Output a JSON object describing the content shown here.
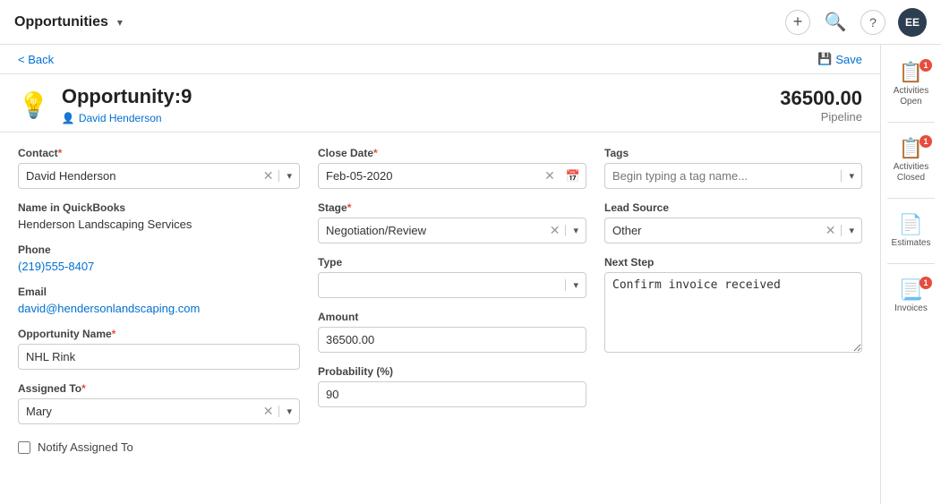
{
  "app": {
    "title": "Opportunities",
    "dropdown_icon": "▾"
  },
  "nav": {
    "add_icon": "+",
    "search_icon": "🔍",
    "help_icon": "?",
    "avatar_initials": "EE"
  },
  "subheader": {
    "back_label": "< Back",
    "save_label": "Save",
    "save_icon": "💾"
  },
  "opportunity": {
    "title": "Opportunity:9",
    "owner_icon": "👤",
    "owner_name": "David  Henderson",
    "amount": "36500.00",
    "pipeline_label": "Pipeline"
  },
  "form": {
    "contact": {
      "label": "Contact",
      "required": true,
      "value": "David Henderson"
    },
    "name_in_quickbooks": {
      "label": "Name in QuickBooks",
      "value": "Henderson Landscaping Services"
    },
    "phone": {
      "label": "Phone",
      "value": "(219)555-8407"
    },
    "email": {
      "label": "Email",
      "value": "david@hendersonlandscaping.com"
    },
    "opportunity_name": {
      "label": "Opportunity Name",
      "required": true,
      "value": "NHL Rink"
    },
    "assigned_to": {
      "label": "Assigned To",
      "required": true,
      "value": "Mary"
    },
    "notify_assigned_to": {
      "label": "Notify Assigned To"
    },
    "close_date": {
      "label": "Close Date",
      "required": true,
      "value": "Feb-05-2020"
    },
    "stage": {
      "label": "Stage",
      "required": true,
      "value": "Negotiation/Review"
    },
    "type": {
      "label": "Type",
      "value": ""
    },
    "amount": {
      "label": "Amount",
      "value": "36500.00"
    },
    "probability": {
      "label": "Probability (%)",
      "value": "90"
    },
    "tags": {
      "label": "Tags",
      "placeholder": "Begin typing a tag name..."
    },
    "lead_source": {
      "label": "Lead Source",
      "value": "Other"
    },
    "next_step": {
      "label": "Next Step",
      "value": "Confirm invoice received"
    }
  },
  "sidebar": {
    "items": [
      {
        "label": "Activities\nOpen",
        "icon": "📋",
        "badge": "1"
      },
      {
        "label": "Activities\nClosed",
        "icon": "📋",
        "badge": "1"
      },
      {
        "label": "Estimates",
        "icon": "📄",
        "badge": null
      },
      {
        "label": "Invoices",
        "icon": "📃",
        "badge": "1"
      }
    ]
  }
}
